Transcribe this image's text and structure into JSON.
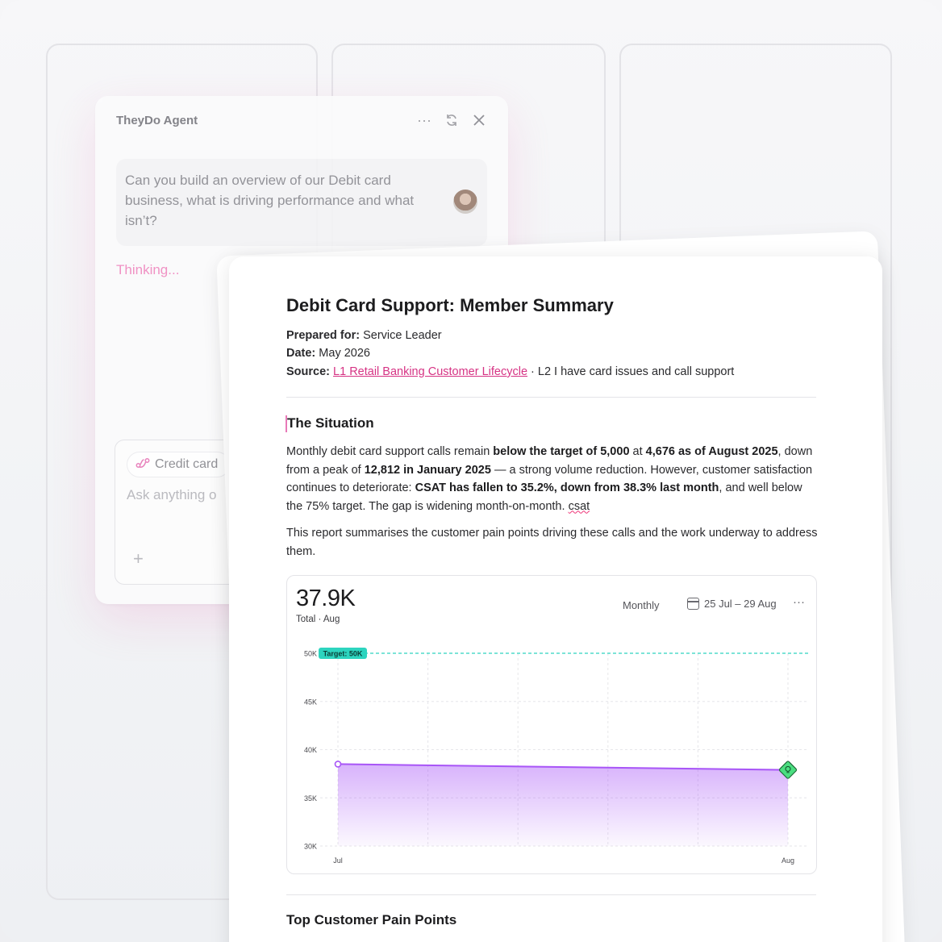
{
  "agent": {
    "title": "TheyDo Agent",
    "more_icon": "more-horizontal-icon",
    "refresh_icon": "refresh-icon",
    "close_icon": "close-icon",
    "user_message": "Can you build an overview of our Debit card business, what is driving performance and what isn’t?",
    "status": "Thinking...",
    "composer": {
      "chip_label": "Credit card",
      "chip_icon": "journey-icon",
      "placeholder": "Ask anything o",
      "add_icon": "plus-icon"
    }
  },
  "document": {
    "title": "Debit Card Support: Member Summary",
    "prepared_for_label": "Prepared for:",
    "prepared_for": "Service Leader",
    "date_label": "Date:",
    "date": "May 2026",
    "source_label": "Source:",
    "source_link": "L1 Retail Banking Customer Lifecycle",
    "source_rest": "· L2 I have card issues and call support",
    "section1_title": "The Situation",
    "p1": {
      "t1": "Monthly debit card support calls remain ",
      "b1": "below the target of 5,000",
      "t2": " at ",
      "b2": "4,676 as of August 2025",
      "t3": ", down from a peak of ",
      "b3": "12,812 in January 2025",
      "t4": " — a strong volume reduction. However, customer satisfaction continues to deteriorate: ",
      "b4": "CSAT has fallen to 35.2%, down from 38.3% last month",
      "t5": ", and well below the 75% target. The gap is widening month-on-month. ",
      "t6": "csat"
    },
    "p2": "This report summarises the customer pain points driving these calls and the work underway to address them.",
    "section2_title": "Top Customer Pain Points",
    "chart_card": {
      "kpi_value": "37.9K",
      "kpi_label": "Total · Aug",
      "period": "Monthly",
      "date_range": "25 Jul – 29 Aug",
      "more": "···"
    }
  },
  "colors": {
    "accent_pink": "#d63384",
    "line_purple": "#a855f7",
    "target_teal": "#2dd4bf",
    "marker_green": "#4ade80"
  },
  "chart_data": {
    "type": "area",
    "categories": [
      "Jul",
      "Aug"
    ],
    "series": [
      {
        "values": [
          38500,
          37900
        ]
      }
    ],
    "target": {
      "label": "Target: 50K",
      "value": 50000
    },
    "ylim": [
      30000,
      50000
    ],
    "yticks": [
      30000,
      35000,
      40000,
      45000,
      50000
    ],
    "ytick_labels": [
      "30K",
      "35K",
      "40K",
      "45K",
      "50K"
    ],
    "grid": true,
    "xlabel": "",
    "ylabel": ""
  }
}
